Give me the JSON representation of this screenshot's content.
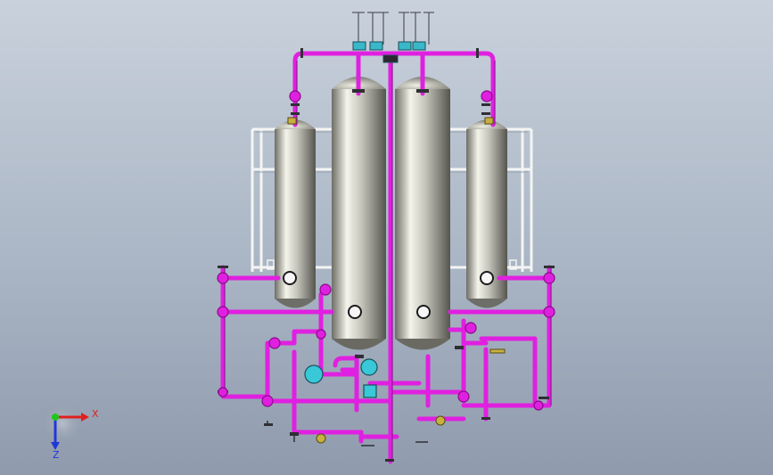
{
  "triad": {
    "x_label": "X",
    "z_label": "Z",
    "x_color": "#e0201c",
    "y_color": "#1ec81e",
    "z_color": "#2038d8"
  },
  "colors": {
    "background_top": "#c9d1dc",
    "background_bottom": "#8f9bad",
    "piping": "#e020e0",
    "piping_dark": "#8a0a8a",
    "valve": "#38b8c8",
    "flange": "#3a3a3a",
    "vessel": "#b8b8b0",
    "frame": "#f2f2f2",
    "brass_fitting": "#c8b040"
  }
}
